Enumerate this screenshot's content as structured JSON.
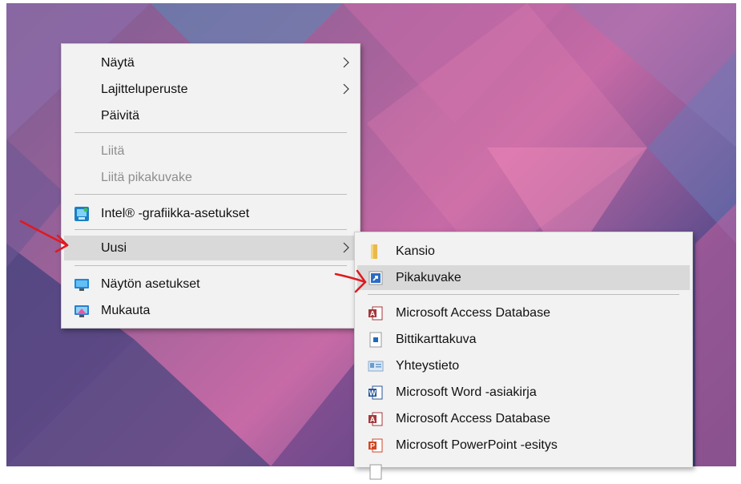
{
  "context_menu": {
    "items": [
      {
        "label": "Näytä"
      },
      {
        "label": "Lajitteluperuste"
      },
      {
        "label": "Päivitä"
      },
      {
        "label": "Liitä"
      },
      {
        "label": "Liitä pikakuvake"
      },
      {
        "label": "Intel® -grafiikka-asetukset"
      },
      {
        "label": "Uusi"
      },
      {
        "label": "Näytön asetukset"
      },
      {
        "label": "Mukauta"
      }
    ]
  },
  "new_submenu": {
    "items": [
      {
        "label": "Kansio"
      },
      {
        "label": "Pikakuvake"
      },
      {
        "label": "Microsoft Access Database"
      },
      {
        "label": "Bittikarttakuva"
      },
      {
        "label": "Yhteystieto"
      },
      {
        "label": "Microsoft Word -asiakirja"
      },
      {
        "label": "Microsoft Access Database"
      },
      {
        "label": "Microsoft PowerPoint -esitys"
      }
    ]
  },
  "colors": {
    "menu_bg": "#f2f2f2",
    "hover_bg": "#d9d9d9",
    "annotation_arrow": "#e0191f",
    "access_red": "#a4373a",
    "word_blue": "#2b579a",
    "powerpoint_orange": "#d24726"
  }
}
